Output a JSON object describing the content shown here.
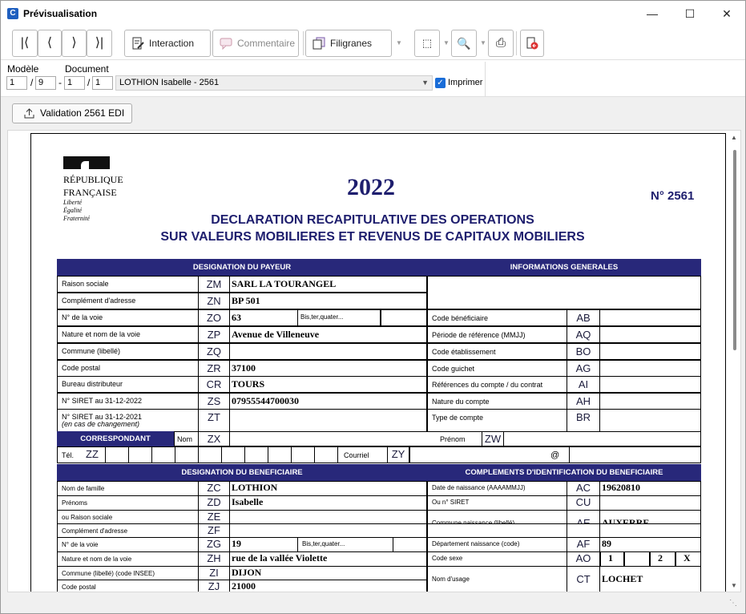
{
  "window": {
    "title": "Prévisualisation",
    "icon_letter": "C"
  },
  "toolbar": {
    "interaction": "Interaction",
    "commentaire": "Commentaire",
    "filigranes": "Filigranes"
  },
  "selector": {
    "modele_label": "Modèle",
    "document_label": "Document",
    "m1": "1",
    "m2": "9",
    "d1": "1",
    "d2": "1",
    "doc_value": "LOTHION Isabelle - 2561",
    "print_label": "Imprimer",
    "print_checked": true
  },
  "validation_label": "Validation 2561 EDI",
  "form": {
    "rep1": "RÉPUBLIQUE",
    "rep2": "FRANÇAISE",
    "motto1": "Liberté",
    "motto2": "Égalité",
    "motto3": "Fraternité",
    "year": "2022",
    "number": "N° 2561",
    "title1": "DECLARATION RECAPITULATIVE DES OPERATIONS",
    "title2": "SUR VALEURS MOBILIERES ET REVENUS DE CAPITAUX MOBILIERS",
    "h_payeur": "DESIGNATION DU PAYEUR",
    "h_info": "INFORMATIONS GENERALES",
    "payeur": [
      {
        "label": "Raison sociale",
        "code": "ZM",
        "value": "SARL LA TOURANGEL"
      },
      {
        "label": "Complément d'adresse",
        "code": "ZN",
        "value": "BP 501"
      },
      {
        "label": "N° de la voie",
        "code": "ZO",
        "value": "63"
      },
      {
        "label": "Nature et nom de la voie",
        "code": "ZP",
        "value": "Avenue de Villeneuve"
      },
      {
        "label": "Commune (libellé)",
        "code": "ZQ",
        "value": ""
      },
      {
        "label": "Code postal",
        "code": "ZR",
        "value": "37100"
      },
      {
        "label": "Bureau distributeur",
        "code": "CR",
        "value": "TOURS"
      },
      {
        "label": "N° SIRET au 31-12-2022",
        "code": "ZS",
        "value": "07955544700030"
      },
      {
        "label": "N° SIRET au 31-12-2021",
        "code": "ZT",
        "value": ""
      }
    ],
    "siret_note": "(en cas de changement)",
    "bis": "Bis,ter,quater...",
    "info": [
      {
        "label": "Code bénéficiaire",
        "code": "AB"
      },
      {
        "label": "Période de référence (MMJJ)",
        "code": "AQ"
      },
      {
        "label": "Code établissement",
        "code": "BO"
      },
      {
        "label": "Code guichet",
        "code": "AG"
      },
      {
        "label": "Références du compte / du contrat",
        "code": "AI"
      },
      {
        "label": "Nature du compte",
        "code": "AH"
      },
      {
        "label": "Type de compte",
        "code": "BR"
      }
    ],
    "corresp": "CORRESPONDANT",
    "nom": "Nom",
    "zx": "ZX",
    "prenom": "Prénom",
    "zw": "ZW",
    "tel": "Tél.",
    "zz": "ZZ",
    "courriel": "Courriel",
    "zy": "ZY",
    "at": "@",
    "h_benef": "DESIGNATION DU BENEFICIAIRE",
    "h_compl": "COMPLEMENTS D'IDENTIFICATION DU BENEFICIAIRE",
    "benef": [
      {
        "label": "Nom de famille",
        "code": "ZC",
        "value": "LOTHION"
      },
      {
        "label": "Prénoms",
        "code": "ZD",
        "value": "Isabelle"
      },
      {
        "label": "ou Raison sociale",
        "code": "ZE",
        "value": ""
      },
      {
        "label": "Complément d'adresse",
        "code": "ZF",
        "value": ""
      },
      {
        "label": "N° de la voie",
        "code": "ZG",
        "value": "19"
      },
      {
        "label": "Nature et nom de la voie",
        "code": "ZH",
        "value": "rue de la vallée Violette"
      },
      {
        "label": "Commune (libellé) (code INSEE)",
        "code": "ZI",
        "value": "DIJON"
      },
      {
        "label": "Code postal",
        "code": "ZJ",
        "value": "21000"
      }
    ],
    "compl": [
      {
        "label": "Date de naissance (AAAAMMJJ)",
        "code": "AC",
        "value": "19620810"
      },
      {
        "label": "Ou n° SIRET",
        "code": "CU",
        "value": ""
      },
      {
        "label": "Commune naissance (libellé)",
        "code": "AE",
        "value": "AUXERRE"
      },
      {
        "label": "Département naissance (code)",
        "code": "AF",
        "value": "89"
      },
      {
        "label": "Code sexe",
        "code": "AO",
        "value": ""
      },
      {
        "label": "Nom d'usage",
        "code": "CT",
        "value": "LOCHET"
      }
    ],
    "sexe1": "1",
    "sexe2": "2",
    "sexe_x": "X"
  }
}
